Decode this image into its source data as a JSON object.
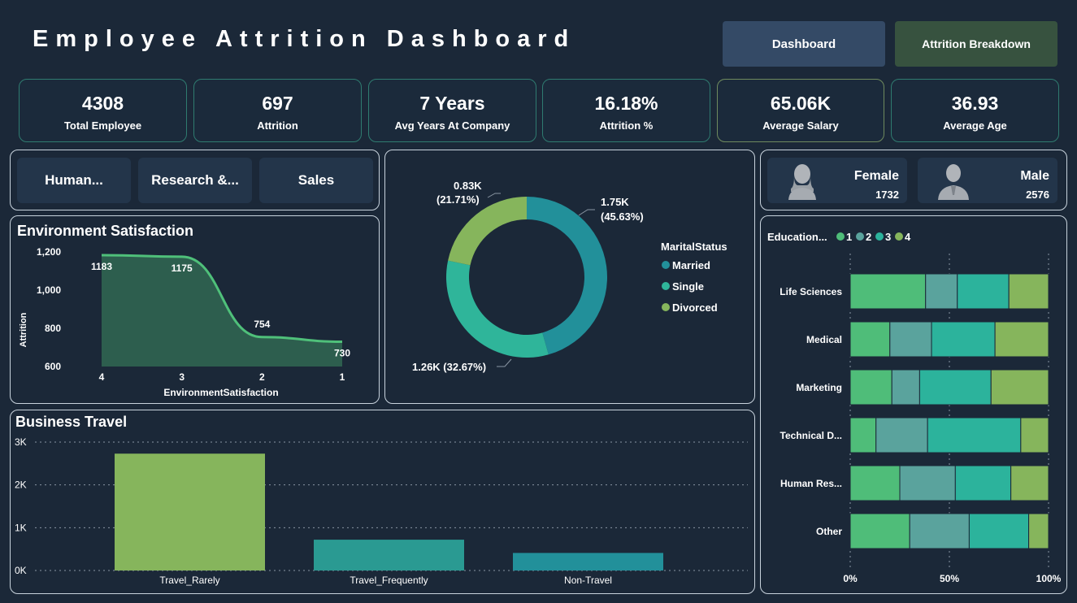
{
  "header": {
    "title": "Employee Attrition Dashboard",
    "nav_dashboard": "Dashboard",
    "nav_attrition": "Attrition Breakdown"
  },
  "kpis": [
    {
      "value": "4308",
      "label": "Total Employee"
    },
    {
      "value": "697",
      "label": "Attrition"
    },
    {
      "value": "7 Years",
      "label": "Avg Years At Company"
    },
    {
      "value": "16.18%",
      "label": "Attrition %"
    },
    {
      "value": "65.06K",
      "label": "Average Salary"
    },
    {
      "value": "36.93",
      "label": "Average Age"
    }
  ],
  "departments": [
    "Human...",
    "Research &...",
    "Sales"
  ],
  "gender": {
    "female_label": "Female",
    "female_count": "1732",
    "male_label": "Male",
    "male_count": "2576"
  },
  "colors": {
    "background": "#1b2838",
    "area_fill": "#2d5e4e",
    "area_line": "#4fc07a",
    "married": "#22909a",
    "single": "#2fb59a",
    "divorced": "#86b55c",
    "edu1": "#4fbd79",
    "edu2": "#5aa39d",
    "edu3": "#2cb39c",
    "edu4": "#86b55c",
    "travel_rarely": "#86b55c",
    "travel_frequently": "#2a9a92",
    "non_travel": "#22909a"
  },
  "chart_data": [
    {
      "id": "environment",
      "type": "area",
      "title": "Environment Satisfaction",
      "xlabel": "EnvironmentSatisfaction",
      "ylabel": "Attrition",
      "categories": [
        "4",
        "3",
        "2",
        "1"
      ],
      "values": [
        1183,
        1175,
        754,
        730
      ],
      "value_labels": [
        "1183",
        "1175",
        "754",
        "730"
      ],
      "ylim": [
        600,
        1200
      ],
      "yticks": [
        "1,200",
        "1,000",
        "800",
        "600"
      ]
    },
    {
      "id": "marital",
      "type": "pie",
      "donut": true,
      "legend_title": "MaritalStatus",
      "categories": [
        "Married",
        "Single",
        "Divorced"
      ],
      "values": [
        45.63,
        32.67,
        21.71
      ],
      "value_labels": [
        "1.75K",
        "1.26K",
        "0.83K"
      ],
      "percent_labels": [
        "(45.63%)",
        "(32.67%)",
        "(21.71%)"
      ],
      "label_texts": [
        "1.26K (32.67%)"
      ],
      "legend_placement": "right"
    },
    {
      "id": "education",
      "type": "bar",
      "orientation": "horizontal",
      "stacked": "percent",
      "legend_title": "Education...",
      "legend_placement": "top-left",
      "categories": [
        "Life Sciences",
        "Medical",
        "Marketing",
        "Technical D...",
        "Human Res...",
        "Other"
      ],
      "series": [
        {
          "name": "1",
          "values": [
            38,
            20,
            21,
            13,
            25,
            30
          ]
        },
        {
          "name": "2",
          "values": [
            16,
            21,
            14,
            26,
            28,
            30
          ]
        },
        {
          "name": "3",
          "values": [
            26,
            32,
            36,
            47,
            28,
            30
          ]
        },
        {
          "name": "4",
          "values": [
            20,
            27,
            29,
            14,
            19,
            10
          ]
        }
      ],
      "xticks": [
        "0%",
        "50%",
        "100%"
      ]
    },
    {
      "id": "travel",
      "type": "bar",
      "title": "Business Travel",
      "categories": [
        "Travel_Rarely",
        "Travel_Frequently",
        "Non-Travel"
      ],
      "values": [
        2730,
        720,
        410
      ],
      "ylim": [
        0,
        3000
      ],
      "yticks": [
        "3K",
        "2K",
        "1K",
        "0K"
      ],
      "grid": true
    }
  ]
}
